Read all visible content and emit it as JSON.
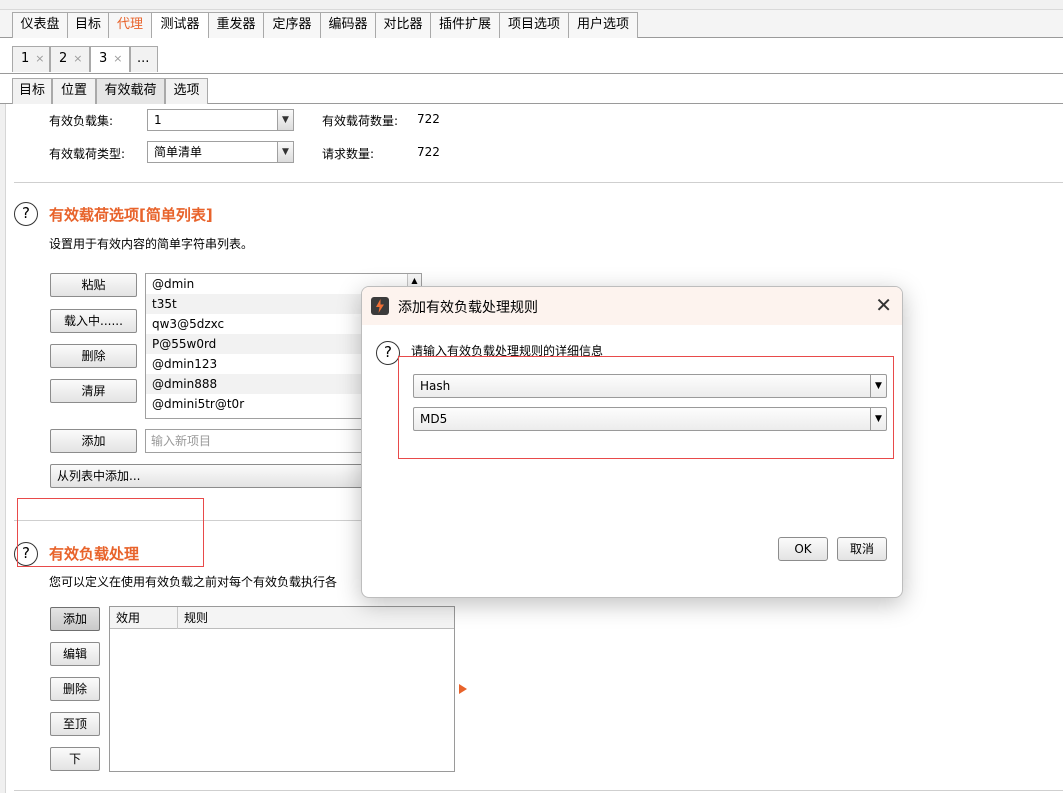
{
  "main_tabs": [
    {
      "label": "仪表盘"
    },
    {
      "label": "目标"
    },
    {
      "label": "代理"
    },
    {
      "label": "测试器"
    },
    {
      "label": "重发器"
    },
    {
      "label": "定序器"
    },
    {
      "label": "编码器"
    },
    {
      "label": "对比器"
    },
    {
      "label": "插件扩展"
    },
    {
      "label": "项目选项"
    },
    {
      "label": "用户选项"
    }
  ],
  "attack_tabs": [
    {
      "label": "1",
      "close": "×"
    },
    {
      "label": "2",
      "close": "×"
    },
    {
      "label": "3",
      "close": "×"
    },
    {
      "label": "..."
    }
  ],
  "inner_tabs": [
    {
      "label": "目标"
    },
    {
      "label": "位置"
    },
    {
      "label": "有效载荷"
    },
    {
      "label": "选项"
    }
  ],
  "payload_sets": {
    "set_label": "有效负载集:",
    "set_value": "1",
    "count_label": "有效载荷数量:",
    "count_value": "722",
    "type_label": "有效载荷类型:",
    "type_value": "简单清单",
    "requests_label": "请求数量:",
    "requests_value": "722"
  },
  "payload_options": {
    "title": "有效载荷选项[简单列表]",
    "description": "设置用于有效内容的简单字符串列表。",
    "buttons": {
      "paste": "粘贴",
      "load": "载入中......",
      "remove": "删除",
      "clear": "清屏",
      "add": "添加",
      "add_from_list": "从列表中添加..."
    },
    "items": [
      "@dmin",
      "t35t",
      "qw3@5dzxc",
      "P@55w0rd",
      "@dmin123",
      "@dmin888",
      "@dmini5tr@t0r"
    ],
    "new_item_placeholder": "输入新项目"
  },
  "payload_processing": {
    "title": "有效负载处理",
    "description": "您可以定义在使用有效负载之前对每个有效负载执行各",
    "buttons": {
      "add": "添加",
      "edit": "编辑",
      "remove": "删除",
      "up": "至顶",
      "down": "下"
    },
    "columns": [
      "效用",
      "规则"
    ]
  },
  "dialog": {
    "title": "添加有效负载处理规则",
    "prompt": "请输入有效负载处理规则的详细信息",
    "rule_type": "Hash",
    "algorithm": "MD5",
    "ok": "OK",
    "cancel": "取消"
  },
  "colors": {
    "accent_orange": "#e8632b",
    "highlight_red": "#e84a4a"
  }
}
